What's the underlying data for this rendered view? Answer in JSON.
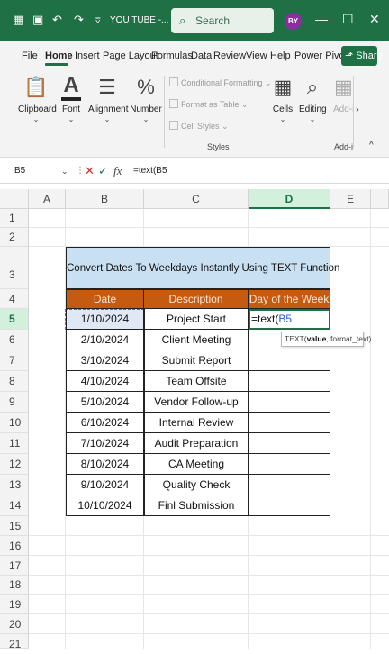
{
  "titlebar": {
    "title": "YOU TUBE -...",
    "search_label": "Search",
    "avatar_initials": "BY",
    "accent_color": "#1f7145"
  },
  "menu": {
    "tabs": [
      "File",
      "Home",
      "Insert",
      "Page Layout",
      "Formulas",
      "Data",
      "Review",
      "View",
      "Help",
      "Power Pivot"
    ],
    "active_tab": "Home",
    "share_label": "Share"
  },
  "ribbon": {
    "clipboard": "Clipboard",
    "font": "Font",
    "alignment": "Alignment",
    "number": "Number",
    "conditional_formatting": "Conditional Formatting",
    "format_as_table": "Format as Table",
    "cell_styles": "Cell Styles",
    "styles_group": "Styles",
    "cells": "Cells",
    "editing": "Editing",
    "addins": "Add-i",
    "addins_group": "Add-i"
  },
  "formula_bar": {
    "name_box": "B5",
    "formula": "=text(B5"
  },
  "grid": {
    "columns": [
      "A",
      "B",
      "C",
      "D",
      "E"
    ],
    "active_column": "D",
    "rows": [
      "1",
      "2",
      "3",
      "4",
      "5",
      "6",
      "7",
      "8",
      "9",
      "10",
      "11",
      "12",
      "13",
      "14",
      "15",
      "16",
      "17",
      "18",
      "19",
      "20",
      "21"
    ],
    "active_row": "5"
  },
  "table": {
    "title": "Convert Dates To Weekdays Instantly Using TEXT Function",
    "headers": [
      "Date",
      "Description",
      "Day of the Week"
    ],
    "rows": [
      {
        "date": "1/10/2024",
        "desc": "Project Start"
      },
      {
        "date": "2/10/2024",
        "desc": "Client Meeting"
      },
      {
        "date": "3/10/2024",
        "desc": "Submit Report"
      },
      {
        "date": "4/10/2024",
        "desc": "Team Offsite"
      },
      {
        "date": "5/10/2024",
        "desc": "Vendor Follow-up"
      },
      {
        "date": "6/10/2024",
        "desc": "Internal Review"
      },
      {
        "date": "7/10/2024",
        "desc": "Audit Preparation"
      },
      {
        "date": "8/10/2024",
        "desc": "CA Meeting"
      },
      {
        "date": "9/10/2024",
        "desc": "Quality Check"
      },
      {
        "date": "10/10/2024",
        "desc": "Finl Submission"
      }
    ],
    "edit_prefix": "=text(",
    "edit_ref": "B5",
    "tooltip_fn": "TEXT(",
    "tooltip_arg1": "value",
    "tooltip_rest": ", format_text)"
  }
}
